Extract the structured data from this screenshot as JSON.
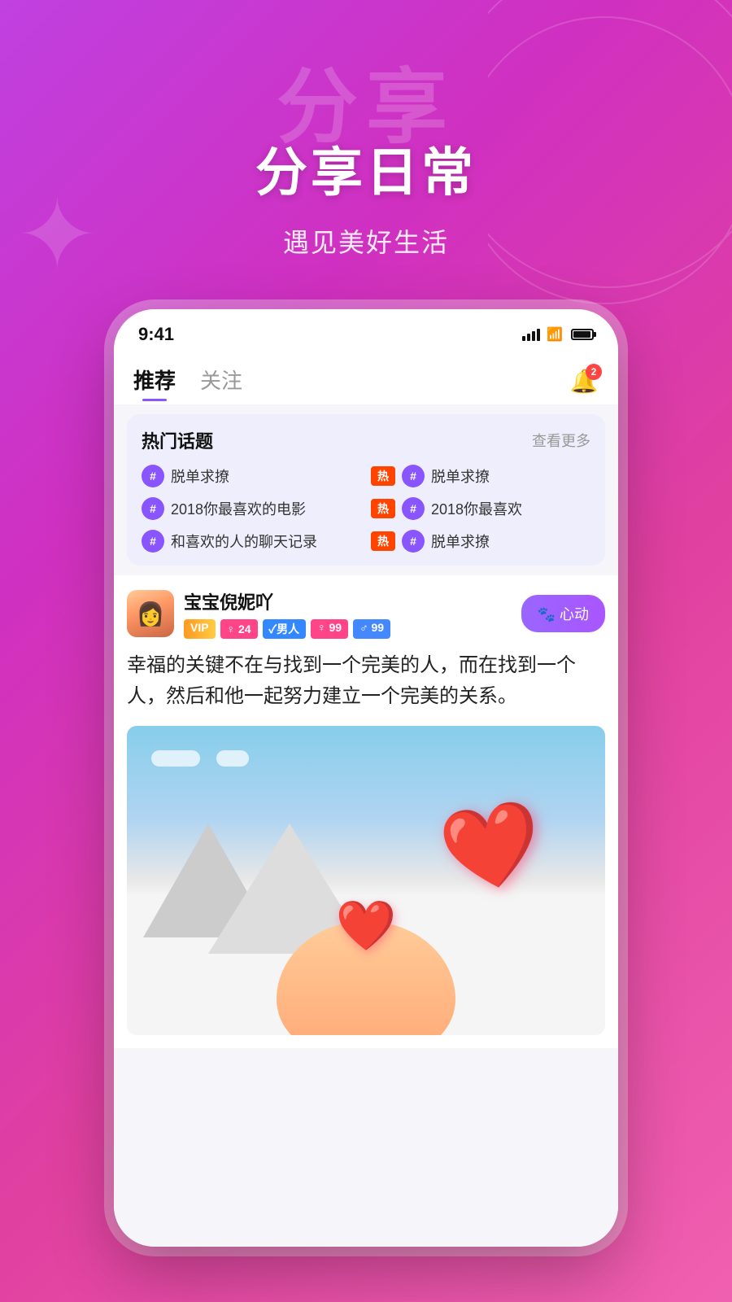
{
  "background": {
    "gradient_start": "#c040e0",
    "gradient_end": "#f060b0"
  },
  "header": {
    "title_bg": "分享",
    "title_main": "分享日常",
    "subtitle": "遇见美好生活"
  },
  "status_bar": {
    "time": "9:41",
    "notification_count": "2"
  },
  "tabs": {
    "active": "推荐",
    "inactive": "关注"
  },
  "hot_topics": {
    "title": "热门话题",
    "more_label": "查看更多",
    "items": [
      {
        "text": "脱单求撩",
        "hot": false
      },
      {
        "text": "脱单求撩",
        "hot": true
      },
      {
        "text": "2018你最喜欢的电影",
        "hot": false
      },
      {
        "text": "2018你最喜欢",
        "hot": true
      },
      {
        "text": "和喜欢的人的聊天记录",
        "hot": false
      },
      {
        "text": "脱单求撩",
        "hot": true
      }
    ]
  },
  "post": {
    "author_name": "宝宝倪妮吖",
    "tag_vip": "VIP",
    "tag_female": "♀ 24",
    "tag_verify": "✓男人",
    "tag_count_f": "♀ 99",
    "tag_count_m": "♂ 99",
    "heart_btn_label": "🐾 心动",
    "text": "幸福的关键不在与找到一个完美的人，而在找到一个人，然后和他一起努力建立一个完美的关系。"
  },
  "icons": {
    "bell": "🔔",
    "heart": "❤️",
    "hashtag": "#"
  }
}
